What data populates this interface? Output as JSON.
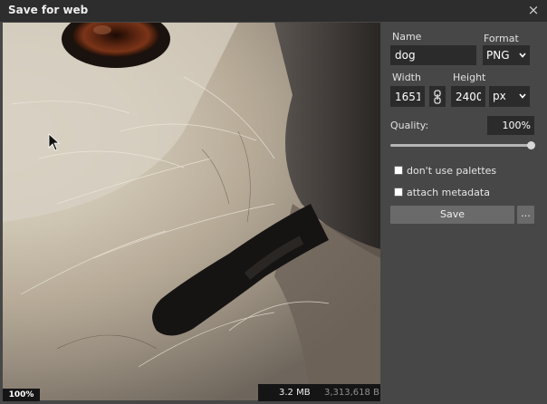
{
  "window": {
    "title": "Save for web",
    "close_glyph": "×"
  },
  "preview": {
    "zoom": "100%",
    "size_mb": "3.2 MB",
    "size_bytes": "3,313,618 B"
  },
  "panel": {
    "name_label": "Name",
    "name_value": "dog",
    "format_label": "Format",
    "format_value": "PNG",
    "width_label": "Width",
    "width_value": "1651",
    "height_label": "Height",
    "height_value": "2400",
    "unit_value": "px",
    "quality_label": "Quality:",
    "quality_value": "100%",
    "quality_level": 1.0,
    "palettes_label": "don't use palettes",
    "metadata_label": "attach metadata",
    "save_label": "Save",
    "more_label": "..."
  },
  "icons": {
    "link": "chain-link-icon",
    "chevron": "chevron-down-icon",
    "close": "close-icon"
  },
  "colors": {
    "panel_bg": "#474747",
    "titlebar_bg": "#2d2d2d",
    "field_bg": "#2b2b2b",
    "button_bg": "#6a6a6a"
  }
}
